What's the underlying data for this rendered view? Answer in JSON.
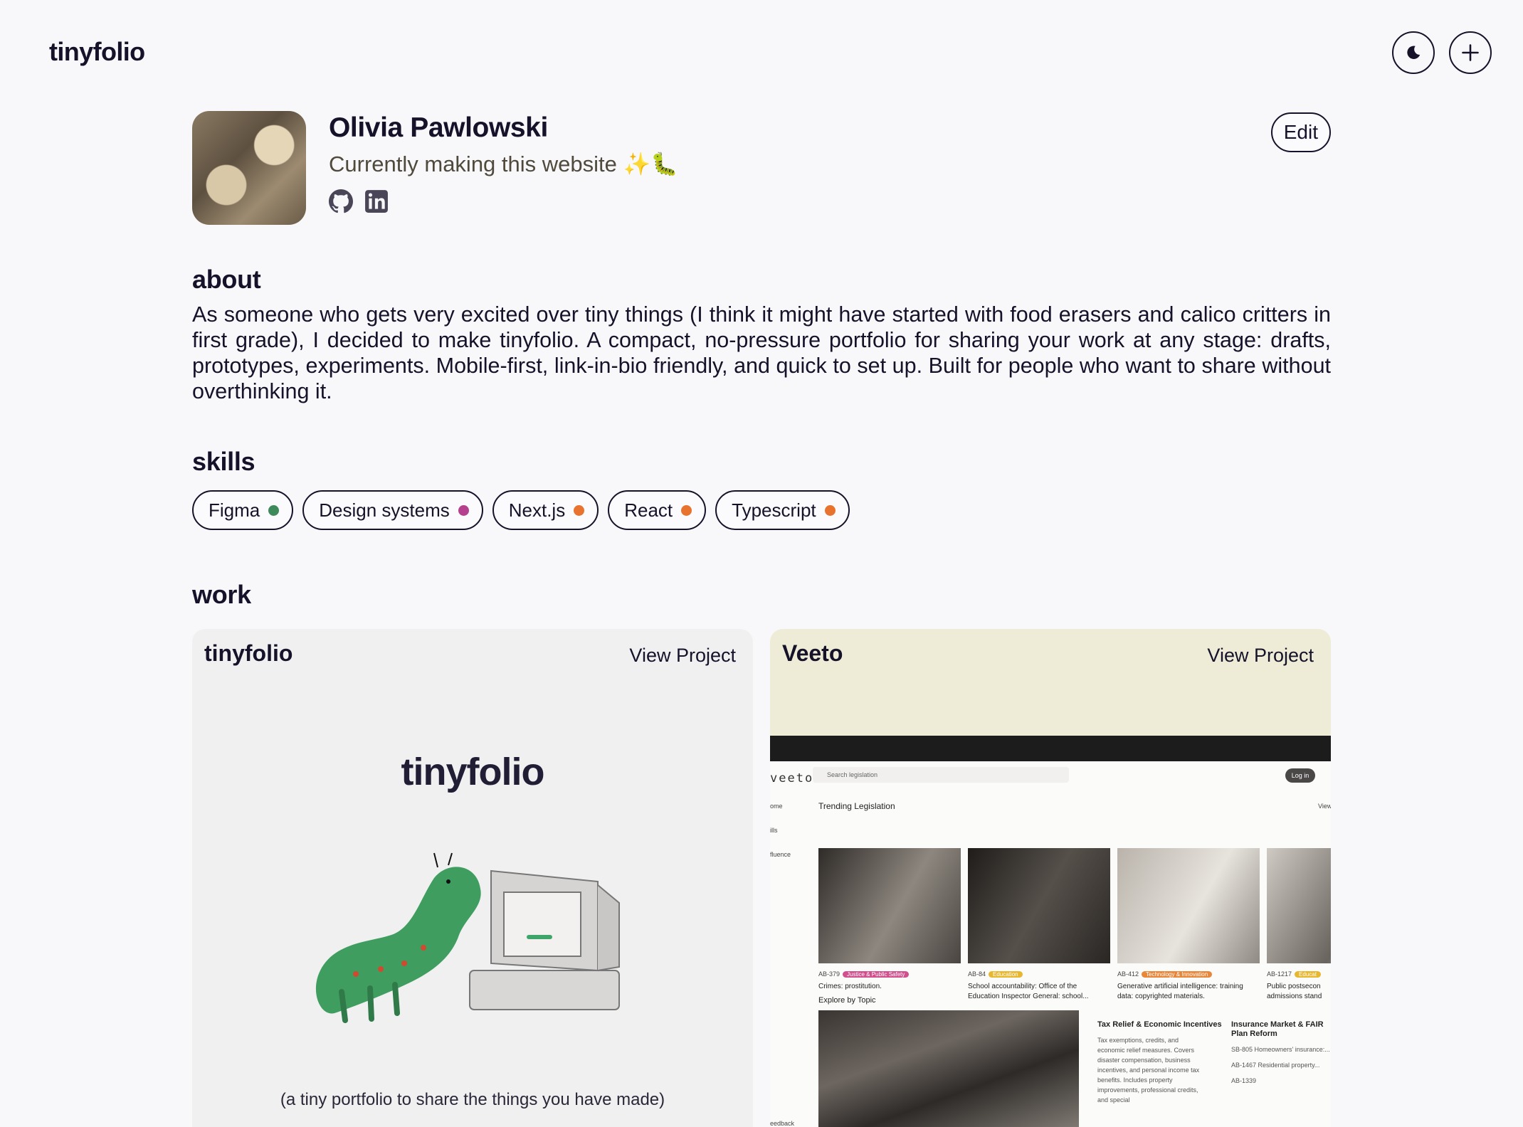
{
  "header": {
    "brand": "tinyfolio",
    "theme_toggle_icon": "moon-icon",
    "add_icon": "plus-icon"
  },
  "profile": {
    "name": "Olivia Pawlowski",
    "tagline": "Currently making this website ✨🐛",
    "edit_label": "Edit",
    "socials": [
      "github-icon",
      "linkedin-icon"
    ]
  },
  "about": {
    "title": "about",
    "body": "As someone who gets very excited over tiny things (I think it might have started with food erasers and calico critters in first grade), I decided to make tinyfolio. A compact, no-pressure portfolio for sharing your work at any stage: drafts, prototypes, experiments. Mobile-first, link-in-bio friendly, and quick to set up. Built for people who want to share without overthinking it."
  },
  "skills": {
    "title": "skills",
    "items": [
      {
        "label": "Figma",
        "color": "#3d8a5a"
      },
      {
        "label": "Design systems",
        "color": "#b5418e"
      },
      {
        "label": "Next.js",
        "color": "#e8732e"
      },
      {
        "label": "React",
        "color": "#e8732e"
      },
      {
        "label": "Typescript",
        "color": "#e8732e"
      }
    ]
  },
  "work": {
    "title": "work",
    "projects": [
      {
        "title": "tinyfolio",
        "link_label": "View Project",
        "hero": "tinyfolio",
        "caption": "(a tiny portfolio to share the things you have made)"
      },
      {
        "title": "Veeto",
        "link_label": "View Project",
        "screenshot": {
          "logo": "veeto",
          "search_placeholder": "Search legislation",
          "login": "Log in",
          "nav": [
            "ome",
            "ills",
            "fluence",
            "eedback"
          ],
          "trending_title": "Trending Legislation",
          "view_all": "View",
          "bills": [
            {
              "id": "AB-379",
              "tag": "Justice & Public Safety",
              "tag_color": "#d24f8e",
              "desc": "Crimes: prostitution."
            },
            {
              "id": "AB-84",
              "tag": "Education",
              "tag_color": "#e8b730",
              "desc": "School accountability: Office of the Education Inspector General: school..."
            },
            {
              "id": "AB-412",
              "tag": "Technology & Innovation",
              "tag_color": "#e8873a",
              "desc": "Generative artificial intelligence: training data: copyrighted materials."
            },
            {
              "id": "AB-1217",
              "tag": "Educat",
              "tag_color": "#e8b730",
              "desc": "Public postsecon admissions stand"
            }
          ],
          "explore_title": "Explore by Topic",
          "topics": [
            {
              "title": "Tax Relief & Economic Incentives",
              "body": "Tax exemptions, credits, and economic relief measures. Covers disaster compensation, business incentives, and personal income tax benefits. Includes property improvements, professional credits, and special"
            },
            {
              "title": "Insurance Market & FAIR Plan Reform",
              "items": [
                "SB-805 Homeowners' insurance:...",
                "AB-1467 Residential property...",
                "AB-1339"
              ]
            }
          ]
        }
      }
    ]
  }
}
